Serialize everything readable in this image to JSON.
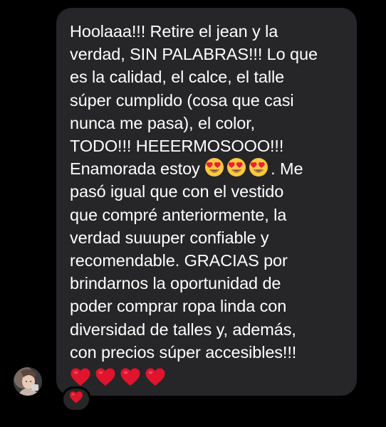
{
  "message": {
    "lines": [
      "Hoolaaa!!! Retire el jean y la",
      "verdad, SIN PALABRAS!!! Lo que",
      "es la calidad, el calce, el talle",
      "súper cumplido (cosa que casi",
      "nunca me pasa), el color,",
      "TODO!!! HEEERMOSOOO!!!",
      "Enamorada estoy",
      "pasó igual que con el vestido",
      "que compré anteriormente, la",
      "verdad suuuper confiable y",
      "recomendable. GRACIAS por",
      "brindarnos la oportunidad de",
      "poder comprar ropa linda con",
      "diversidad de talles y, además,",
      "con precios súper accesibles!!!"
    ],
    "line7_suffix": ". Me",
    "emojis": [
      "heart-eyes-emoji",
      "heart-eyes-emoji",
      "heart-eyes-emoji"
    ],
    "hearts": [
      "red-heart-emoji",
      "red-heart-emoji",
      "red-heart-emoji",
      "red-heart-emoji"
    ]
  },
  "reaction": {
    "emoji": "red-heart-emoji"
  },
  "colors": {
    "background": "#000000",
    "bubble": "#262628",
    "text": "#ffffff",
    "heart": "#e0142c",
    "emoji_face": "#ffc83d"
  }
}
